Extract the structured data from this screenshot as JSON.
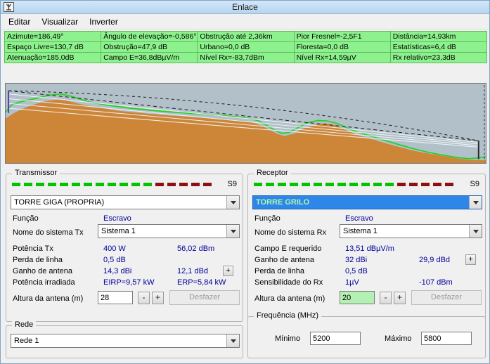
{
  "window": {
    "title": "Enlace"
  },
  "menu": {
    "items": [
      "Editar",
      "Visualizar",
      "Inverter"
    ]
  },
  "stats": {
    "rows": [
      [
        "Azimute=186,49°",
        "Ângulo de elevação=-0,586°",
        "Obstrução até 2,36km",
        "Pior Fresnel=-2,5F1",
        "Distância=14,93km"
      ],
      [
        "Espaço Livre=130,7 dB",
        "Obstrução=47,9 dB",
        "Urbano=0,0 dB",
        "Floresta=0,0 dB",
        "Estatísticas=6,4 dB"
      ],
      [
        "Atenuação=185,0dB",
        "Campo E=36,8dBµV/m",
        "Nível Rx=-83,7dBm",
        "Nível Rx=14,59µV",
        "Rx relativo=23,3dB"
      ]
    ]
  },
  "chart_data": {
    "type": "area",
    "title": "Radio link terrain elevation profile",
    "xlabel": "",
    "ylabel": "",
    "x_range_km": [
      0,
      14.93
    ],
    "legend": false,
    "grid": false,
    "colors": {
      "sky": "#b2c0c9",
      "terrain": "#cd8538",
      "canopy": "#1fd41f",
      "beam": "#f2f6f8",
      "los": "#1c1c1c",
      "tx_mast": "#5b3fae",
      "rx_mast": "#2a2a2a"
    },
    "canopy": [
      [
        0,
        0.36
      ],
      [
        0.012,
        0.27
      ],
      [
        0.03,
        0.23
      ],
      [
        0.06,
        0.19
      ],
      [
        0.09,
        0.145
      ],
      [
        0.115,
        0.13
      ],
      [
        0.14,
        0.165
      ],
      [
        0.17,
        0.225
      ],
      [
        0.21,
        0.27
      ],
      [
        0.26,
        0.31
      ],
      [
        0.31,
        0.34
      ],
      [
        0.36,
        0.365
      ],
      [
        0.41,
        0.385
      ],
      [
        0.46,
        0.405
      ],
      [
        0.5,
        0.43
      ],
      [
        0.525,
        0.465
      ],
      [
        0.545,
        0.53
      ],
      [
        0.56,
        0.585
      ],
      [
        0.575,
        0.625
      ],
      [
        0.59,
        0.615
      ],
      [
        0.61,
        0.55
      ],
      [
        0.63,
        0.49
      ],
      [
        0.65,
        0.465
      ],
      [
        0.67,
        0.47
      ],
      [
        0.69,
        0.5
      ],
      [
        0.71,
        0.555
      ],
      [
        0.735,
        0.615
      ],
      [
        0.76,
        0.66
      ],
      [
        0.79,
        0.715
      ],
      [
        0.82,
        0.77
      ],
      [
        0.85,
        0.82
      ],
      [
        0.88,
        0.865
      ],
      [
        0.91,
        0.9
      ],
      [
        0.94,
        0.93
      ],
      [
        0.965,
        0.945
      ],
      [
        0.985,
        0.935
      ],
      [
        1,
        0.92
      ]
    ],
    "terrain": [
      [
        0,
        0.44
      ],
      [
        0.02,
        0.36
      ],
      [
        0.05,
        0.28
      ],
      [
        0.08,
        0.225
      ],
      [
        0.115,
        0.195
      ],
      [
        0.15,
        0.25
      ],
      [
        0.19,
        0.3
      ],
      [
        0.24,
        0.345
      ],
      [
        0.29,
        0.375
      ],
      [
        0.34,
        0.4
      ],
      [
        0.39,
        0.42
      ],
      [
        0.44,
        0.44
      ],
      [
        0.49,
        0.465
      ],
      [
        0.52,
        0.5
      ],
      [
        0.545,
        0.565
      ],
      [
        0.565,
        0.63
      ],
      [
        0.58,
        0.66
      ],
      [
        0.6,
        0.63
      ],
      [
        0.62,
        0.565
      ],
      [
        0.645,
        0.515
      ],
      [
        0.665,
        0.5
      ],
      [
        0.685,
        0.52
      ],
      [
        0.705,
        0.575
      ],
      [
        0.73,
        0.64
      ],
      [
        0.755,
        0.685
      ],
      [
        0.785,
        0.74
      ],
      [
        0.815,
        0.79
      ],
      [
        0.85,
        0.845
      ],
      [
        0.885,
        0.885
      ],
      [
        0.915,
        0.915
      ],
      [
        0.945,
        0.945
      ],
      [
        0.97,
        0.96
      ],
      [
        1,
        0.965
      ]
    ],
    "los": [
      [
        0.006,
        0.09
      ],
      [
        0.985,
        0.72
      ]
    ],
    "fresnel_arc": [
      [
        0.006,
        0.09
      ],
      [
        0.5,
        0.16
      ],
      [
        0.985,
        0.72
      ]
    ],
    "beams": [
      [
        [
          0.006,
          0.13
        ],
        [
          0.985,
          0.74
        ]
      ],
      [
        [
          0.006,
          0.19
        ],
        [
          0.985,
          0.76
        ]
      ],
      [
        [
          0.006,
          0.25
        ],
        [
          0.985,
          0.78
        ]
      ],
      [
        [
          0.006,
          0.31
        ],
        [
          0.985,
          0.8
        ]
      ]
    ],
    "tx_mast": [
      0.006,
      0.09,
      0.37
    ],
    "rx_mast": [
      0.985,
      0.72,
      0.95
    ],
    "right_boundary": 0.997
  },
  "tx": {
    "title": "Transmissor",
    "signal": {
      "label": "S9",
      "green": 12,
      "red": 5
    },
    "station": "TORRE GIGA (PROPRIA)",
    "role_label": "Função",
    "role_value": "Escravo",
    "system_label": "Nome do sistema Tx",
    "system_value": "Sistema  1",
    "rows": [
      {
        "label": "Potência Tx",
        "v1": "400 W",
        "v2": "56,02 dBm"
      },
      {
        "label": "Perda de linha",
        "v1": "0,5 dB",
        "v2": ""
      },
      {
        "label": "Ganho de antena",
        "v1": "14,3 dBi",
        "v2": "12,1 dBd"
      },
      {
        "label": "Potência irradiada",
        "v1": "EIRP=9,57 kW",
        "v2": "ERP=5,84 kW"
      }
    ],
    "height_label": "Altura da antena (m)",
    "height_value": "28",
    "minus_label": "-",
    "plus_label": "+",
    "undo_label": "Desfazer"
  },
  "rx": {
    "title": "Receptor",
    "signal": {
      "label": "S9",
      "green": 12,
      "red": 5
    },
    "station": "TORRE GRILO",
    "role_label": "Função",
    "role_value": "Escravo",
    "system_label": "Nome do sistema Rx",
    "system_value": "Sistema  1",
    "rows": [
      {
        "label": "Campo E requerido",
        "v1": "13,51 dBµV/m",
        "v2": ""
      },
      {
        "label": "Ganho de antena",
        "v1": "32 dBi",
        "v2": "29,9 dBd"
      },
      {
        "label": "Perda de linha",
        "v1": "0,5 dB",
        "v2": ""
      },
      {
        "label": "Sensibilidade do Rx",
        "v1": "1µV",
        "v2": "-107 dBm"
      }
    ],
    "height_label": "Altura da antena (m)",
    "height_value": "20",
    "minus_label": "-",
    "plus_label": "+",
    "undo_label": "Desfazer"
  },
  "rede": {
    "title": "Rede",
    "value": "Rede  1"
  },
  "freq": {
    "title": "Frequência (MHz)",
    "min_label": "Mínimo",
    "min_value": "5200",
    "max_label": "Máximo",
    "max_value": "5800"
  }
}
